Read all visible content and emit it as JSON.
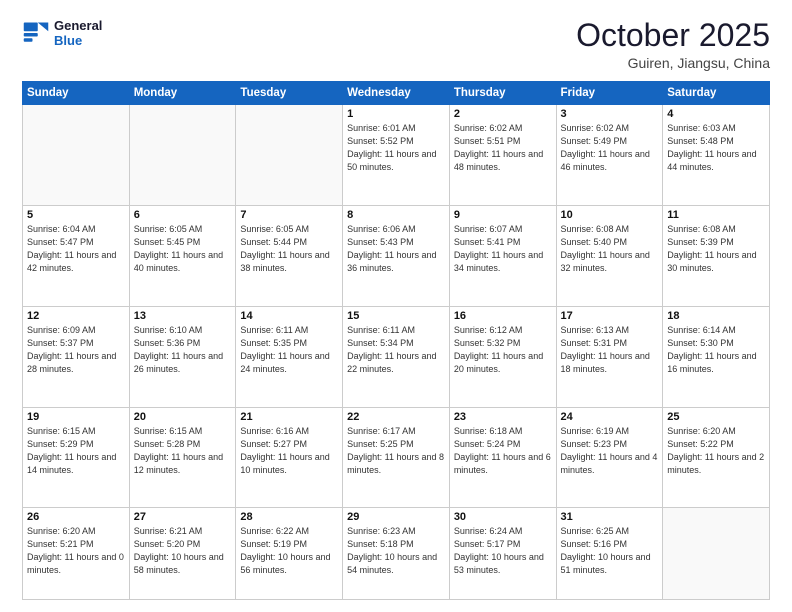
{
  "header": {
    "logo_line1": "General",
    "logo_line2": "Blue",
    "month": "October 2025",
    "location": "Guiren, Jiangsu, China"
  },
  "weekdays": [
    "Sunday",
    "Monday",
    "Tuesday",
    "Wednesday",
    "Thursday",
    "Friday",
    "Saturday"
  ],
  "weeks": [
    [
      {
        "day": "",
        "detail": ""
      },
      {
        "day": "",
        "detail": ""
      },
      {
        "day": "",
        "detail": ""
      },
      {
        "day": "1",
        "detail": "Sunrise: 6:01 AM\nSunset: 5:52 PM\nDaylight: 11 hours\nand 50 minutes."
      },
      {
        "day": "2",
        "detail": "Sunrise: 6:02 AM\nSunset: 5:51 PM\nDaylight: 11 hours\nand 48 minutes."
      },
      {
        "day": "3",
        "detail": "Sunrise: 6:02 AM\nSunset: 5:49 PM\nDaylight: 11 hours\nand 46 minutes."
      },
      {
        "day": "4",
        "detail": "Sunrise: 6:03 AM\nSunset: 5:48 PM\nDaylight: 11 hours\nand 44 minutes."
      }
    ],
    [
      {
        "day": "5",
        "detail": "Sunrise: 6:04 AM\nSunset: 5:47 PM\nDaylight: 11 hours\nand 42 minutes."
      },
      {
        "day": "6",
        "detail": "Sunrise: 6:05 AM\nSunset: 5:45 PM\nDaylight: 11 hours\nand 40 minutes."
      },
      {
        "day": "7",
        "detail": "Sunrise: 6:05 AM\nSunset: 5:44 PM\nDaylight: 11 hours\nand 38 minutes."
      },
      {
        "day": "8",
        "detail": "Sunrise: 6:06 AM\nSunset: 5:43 PM\nDaylight: 11 hours\nand 36 minutes."
      },
      {
        "day": "9",
        "detail": "Sunrise: 6:07 AM\nSunset: 5:41 PM\nDaylight: 11 hours\nand 34 minutes."
      },
      {
        "day": "10",
        "detail": "Sunrise: 6:08 AM\nSunset: 5:40 PM\nDaylight: 11 hours\nand 32 minutes."
      },
      {
        "day": "11",
        "detail": "Sunrise: 6:08 AM\nSunset: 5:39 PM\nDaylight: 11 hours\nand 30 minutes."
      }
    ],
    [
      {
        "day": "12",
        "detail": "Sunrise: 6:09 AM\nSunset: 5:37 PM\nDaylight: 11 hours\nand 28 minutes."
      },
      {
        "day": "13",
        "detail": "Sunrise: 6:10 AM\nSunset: 5:36 PM\nDaylight: 11 hours\nand 26 minutes."
      },
      {
        "day": "14",
        "detail": "Sunrise: 6:11 AM\nSunset: 5:35 PM\nDaylight: 11 hours\nand 24 minutes."
      },
      {
        "day": "15",
        "detail": "Sunrise: 6:11 AM\nSunset: 5:34 PM\nDaylight: 11 hours\nand 22 minutes."
      },
      {
        "day": "16",
        "detail": "Sunrise: 6:12 AM\nSunset: 5:32 PM\nDaylight: 11 hours\nand 20 minutes."
      },
      {
        "day": "17",
        "detail": "Sunrise: 6:13 AM\nSunset: 5:31 PM\nDaylight: 11 hours\nand 18 minutes."
      },
      {
        "day": "18",
        "detail": "Sunrise: 6:14 AM\nSunset: 5:30 PM\nDaylight: 11 hours\nand 16 minutes."
      }
    ],
    [
      {
        "day": "19",
        "detail": "Sunrise: 6:15 AM\nSunset: 5:29 PM\nDaylight: 11 hours\nand 14 minutes."
      },
      {
        "day": "20",
        "detail": "Sunrise: 6:15 AM\nSunset: 5:28 PM\nDaylight: 11 hours\nand 12 minutes."
      },
      {
        "day": "21",
        "detail": "Sunrise: 6:16 AM\nSunset: 5:27 PM\nDaylight: 11 hours\nand 10 minutes."
      },
      {
        "day": "22",
        "detail": "Sunrise: 6:17 AM\nSunset: 5:25 PM\nDaylight: 11 hours\nand 8 minutes."
      },
      {
        "day": "23",
        "detail": "Sunrise: 6:18 AM\nSunset: 5:24 PM\nDaylight: 11 hours\nand 6 minutes."
      },
      {
        "day": "24",
        "detail": "Sunrise: 6:19 AM\nSunset: 5:23 PM\nDaylight: 11 hours\nand 4 minutes."
      },
      {
        "day": "25",
        "detail": "Sunrise: 6:20 AM\nSunset: 5:22 PM\nDaylight: 11 hours\nand 2 minutes."
      }
    ],
    [
      {
        "day": "26",
        "detail": "Sunrise: 6:20 AM\nSunset: 5:21 PM\nDaylight: 11 hours\nand 0 minutes."
      },
      {
        "day": "27",
        "detail": "Sunrise: 6:21 AM\nSunset: 5:20 PM\nDaylight: 10 hours\nand 58 minutes."
      },
      {
        "day": "28",
        "detail": "Sunrise: 6:22 AM\nSunset: 5:19 PM\nDaylight: 10 hours\nand 56 minutes."
      },
      {
        "day": "29",
        "detail": "Sunrise: 6:23 AM\nSunset: 5:18 PM\nDaylight: 10 hours\nand 54 minutes."
      },
      {
        "day": "30",
        "detail": "Sunrise: 6:24 AM\nSunset: 5:17 PM\nDaylight: 10 hours\nand 53 minutes."
      },
      {
        "day": "31",
        "detail": "Sunrise: 6:25 AM\nSunset: 5:16 PM\nDaylight: 10 hours\nand 51 minutes."
      },
      {
        "day": "",
        "detail": ""
      }
    ]
  ]
}
